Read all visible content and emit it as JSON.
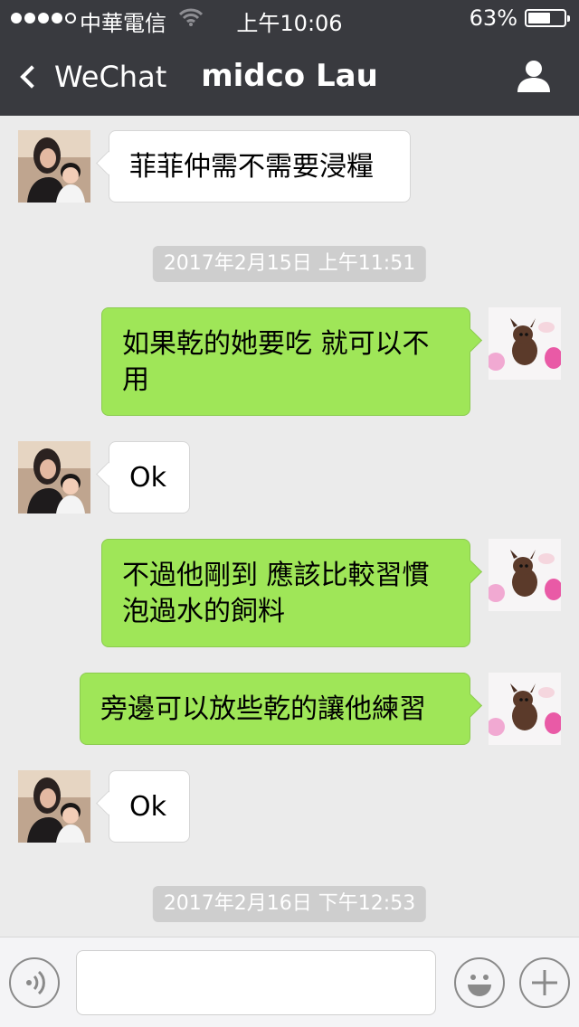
{
  "status_bar": {
    "carrier": "中華電信",
    "time": "上午10:06",
    "battery": "63%",
    "battery_level": 0.63
  },
  "nav": {
    "back_label": "WeChat",
    "title": "midco Lau"
  },
  "messages": [
    {
      "type": "text",
      "from": "contact",
      "text": "菲菲仲需不需要浸糧"
    },
    {
      "type": "timestamp",
      "text": "2017年2月15日 上午11:51"
    },
    {
      "type": "text",
      "from": "me",
      "text": "如果乾的她要吃 就可以不用"
    },
    {
      "type": "text",
      "from": "contact",
      "text": "Ok"
    },
    {
      "type": "text",
      "from": "me",
      "text": "不過他剛到 應該比較習慣泡過水的飼料"
    },
    {
      "type": "text",
      "from": "me",
      "text": "旁邊可以放些乾的讓他練習"
    },
    {
      "type": "text",
      "from": "contact",
      "text": "Ok"
    },
    {
      "type": "timestamp",
      "text": "2017年2月16日 下午12:53"
    }
  ],
  "input_bar": {
    "left_icon": "voice-icon",
    "right_icons": [
      "emoji-icon",
      "plus-icon"
    ]
  }
}
